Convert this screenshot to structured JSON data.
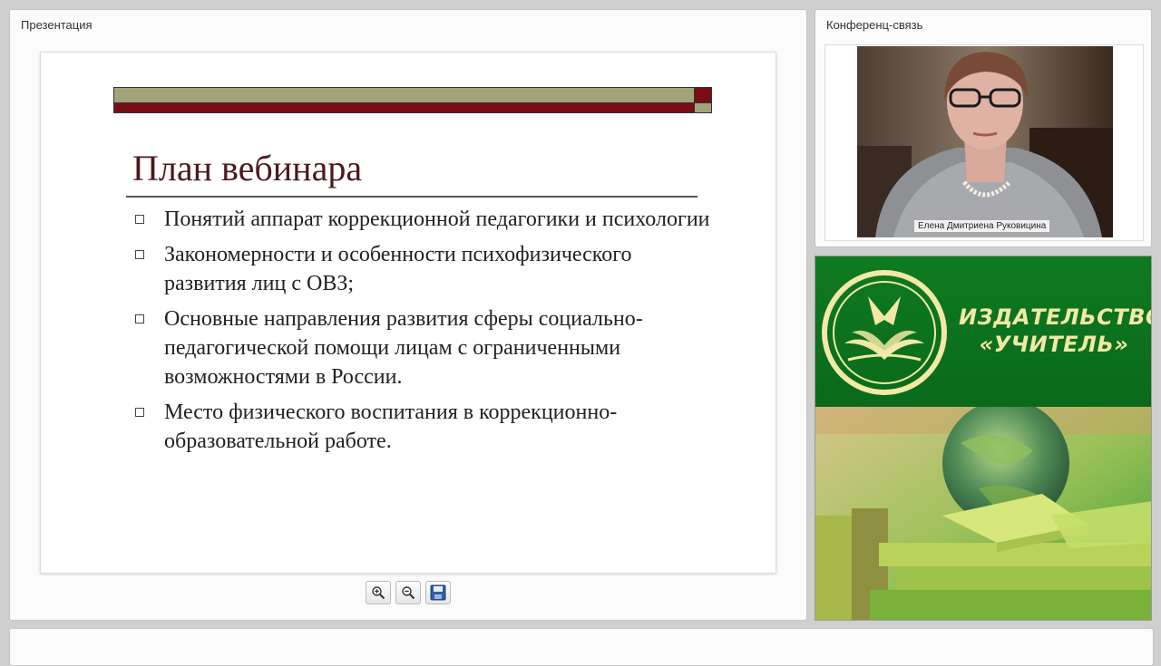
{
  "presentation": {
    "panel_title": "Презентация",
    "slide": {
      "title": "План вебинара",
      "bullets": [
        "Понятий аппарат коррекционной педагогики и психологии",
        "Закономерности и особенности психофизического развития  лиц с ОВЗ;",
        "Основные направления развития сферы социально-педагогической помощи лицам с ограниченными возможностями в России.",
        "Место физического воспитания в коррекционно-образовательной работе."
      ]
    },
    "tools": [
      {
        "name": "zoom-in-icon"
      },
      {
        "name": "zoom-out-icon"
      },
      {
        "name": "save-icon"
      }
    ]
  },
  "conference": {
    "panel_title": "Конференц-связь",
    "speaker_name": "Елена Дмитриена Руковицина"
  },
  "publisher": {
    "name_line1": "ИЗДАТЕЛЬСТВО",
    "name_line2": "«УЧИТЕЛЬ»"
  },
  "colors": {
    "slide_title": "#4a1a1e",
    "bar_olive": "#a3a37a",
    "bar_red": "#7a0c15",
    "publisher_green": "#0e7a20",
    "publisher_text": "#f1e9a5"
  }
}
